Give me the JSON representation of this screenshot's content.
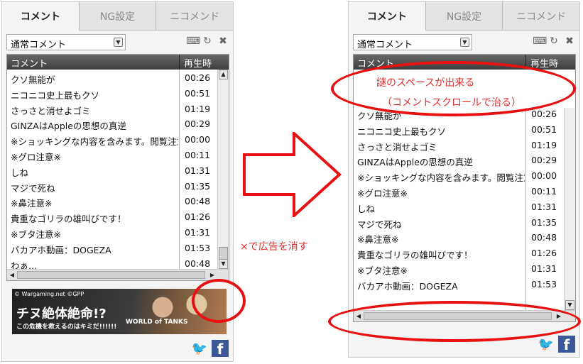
{
  "tabs": [
    "コメント",
    "NG設定",
    "ニコメンド"
  ],
  "filter": {
    "selected": "通常コメント"
  },
  "list": {
    "col_comment": "コメント",
    "col_time": "再生時",
    "rows": [
      {
        "comment": "クソ無能が",
        "time": "00:26"
      },
      {
        "comment": "ニコニコ史上最もクソ",
        "time": "00:51"
      },
      {
        "comment": "さっさと消せよゴミ",
        "time": "01:19"
      },
      {
        "comment": "GINZAはAppleの思想の真逆",
        "time": "00:29"
      },
      {
        "comment": "※ショッキングな内容を含みます。閲覧注意",
        "time": "00:00"
      },
      {
        "comment": "※グロ注意※",
        "time": "00:11"
      },
      {
        "comment": "しね",
        "time": "01:31"
      },
      {
        "comment": "マジで死ね",
        "time": "01:35"
      },
      {
        "comment": "※鼻注意※",
        "time": "00:48"
      },
      {
        "comment": "貴重なゴリラの雄叫びです！",
        "time": "01:26"
      },
      {
        "comment": "※ブタ注意※",
        "time": "01:31"
      },
      {
        "comment": "バカアホ動画：DOGEZA",
        "time": "01:53"
      },
      {
        "comment": "わぁ…",
        "time": "00:48"
      }
    ],
    "rows_right": [
      {
        "comment": "クソ無能が",
        "time": "00:26"
      },
      {
        "comment": "ニコニコ史上最もクソ",
        "time": "00:51"
      },
      {
        "comment": "さっさと消せよゴミ",
        "time": "01:19"
      },
      {
        "comment": "GINZAはAppleの思想の真逆",
        "time": "00:29"
      },
      {
        "comment": "※ショッキングな内容を含みます。閲覧注意",
        "time": "00:00"
      },
      {
        "comment": "※グロ注意※",
        "time": "00:11"
      },
      {
        "comment": "しね",
        "time": "01:31"
      },
      {
        "comment": "マジで死ね",
        "time": "01:35"
      },
      {
        "comment": "※鼻注意※",
        "time": "00:48"
      },
      {
        "comment": "貴重なゴリラの雄叫びです！",
        "time": "01:26"
      },
      {
        "comment": "※ブタ注意※",
        "time": "01:31"
      },
      {
        "comment": "バカアホ動画：DOGEZA",
        "time": "01:53"
      }
    ]
  },
  "ad": {
    "credit": "© Wargaming.net ©GPP",
    "headline": "チヌ絶体絶命!?",
    "sub": "この危機を救えるのはキミだ!!!!!!",
    "brand": "WORLD of TANKS"
  },
  "annotations": {
    "close_ad": "×で広告を消す",
    "space_line1": "謎のスペースが出来る",
    "space_line2": "（コメントスクロールで治る）"
  },
  "colors": {
    "accent_red": "#e81010",
    "twitter": "#1da1f2",
    "facebook": "#3b5998"
  },
  "icons": [
    "dropdown-icon",
    "keyboard-icon",
    "refresh-icon",
    "close-icon",
    "twitter-icon",
    "facebook-icon"
  ]
}
